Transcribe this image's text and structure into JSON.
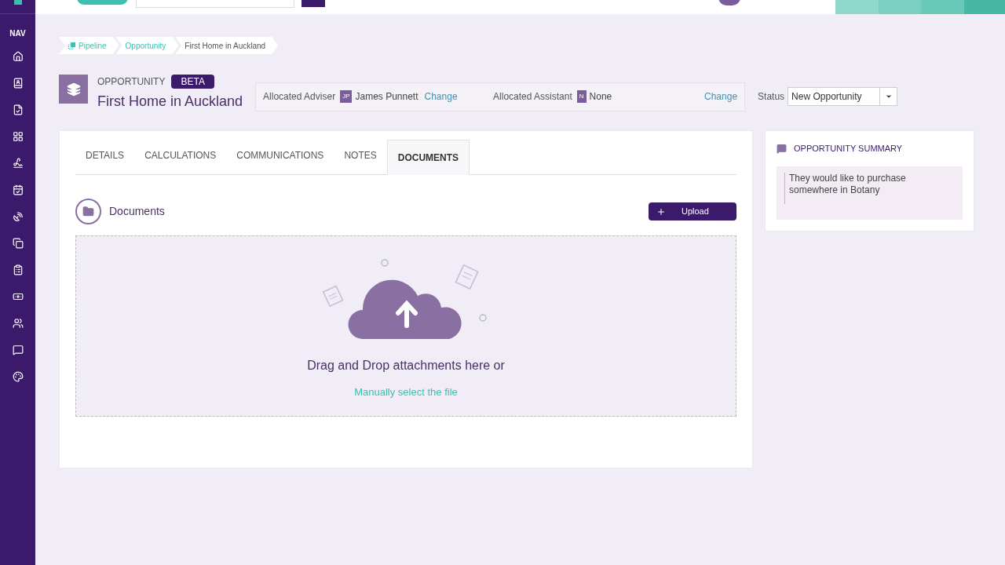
{
  "nav": {
    "label": "NAV"
  },
  "breadcrumbs": [
    {
      "label": "Pipeline",
      "kind": "link"
    },
    {
      "label": "Opportunity",
      "kind": "link"
    },
    {
      "label": "First Home in Auckland",
      "kind": "current"
    }
  ],
  "header": {
    "eyebrow": "OPPORTUNITY",
    "badge": "BETA",
    "title": "First Home in Auckland"
  },
  "allocations": [
    {
      "label": "Allocated Adviser",
      "initials": "JP",
      "name": "James Punnett",
      "action": "Change"
    },
    {
      "label": "Allocated Assistant",
      "initials": "N",
      "name": "None",
      "action": "Change"
    }
  ],
  "status": {
    "label": "Status",
    "value": "New Opportunity"
  },
  "tabs": [
    {
      "label": "DETAILS",
      "selected": false
    },
    {
      "label": "CALCULATIONS",
      "selected": false
    },
    {
      "label": "COMMUNICATIONS",
      "selected": false
    },
    {
      "label": "NOTES",
      "selected": false
    },
    {
      "label": "DOCUMENTS",
      "selected": true
    }
  ],
  "documents": {
    "title": "Documents",
    "upload": "Upload",
    "drop_text": "Drag and Drop attachments here or",
    "select_link": "Manually select the file"
  },
  "summary": {
    "title": "OPPORTUNITY SUMMARY",
    "text": "They would like to purchase somewhere in Botany"
  }
}
